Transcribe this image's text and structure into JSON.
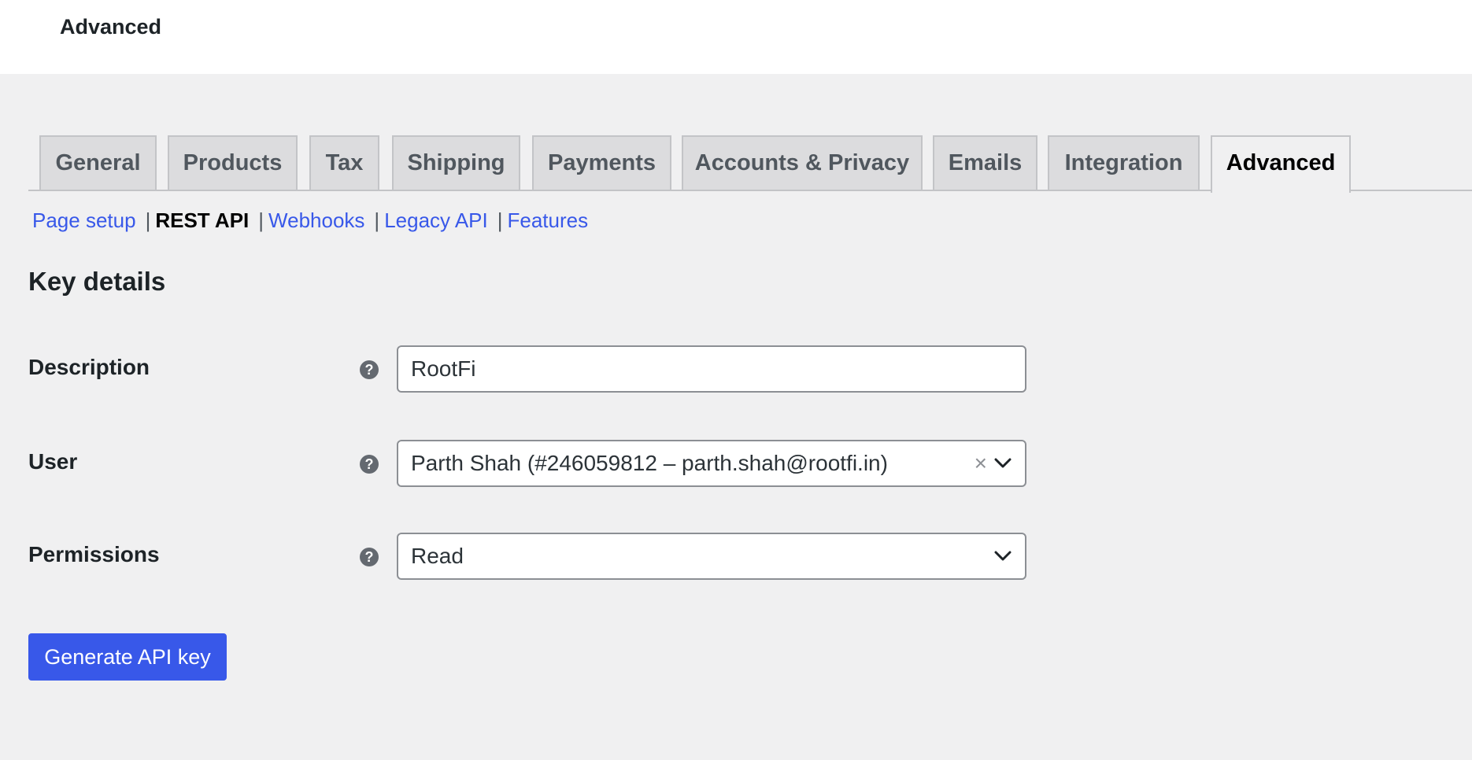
{
  "header": {
    "title": "Advanced"
  },
  "tabs": [
    {
      "label": "General"
    },
    {
      "label": "Products"
    },
    {
      "label": "Tax"
    },
    {
      "label": "Shipping"
    },
    {
      "label": "Payments"
    },
    {
      "label": "Accounts & Privacy"
    },
    {
      "label": "Emails"
    },
    {
      "label": "Integration"
    },
    {
      "label": "Advanced",
      "active": true
    }
  ],
  "subnav": {
    "items": [
      {
        "label": "Page setup"
      },
      {
        "label": "REST API",
        "current": true
      },
      {
        "label": "Webhooks"
      },
      {
        "label": "Legacy API"
      },
      {
        "label": "Features"
      }
    ],
    "separator": "|"
  },
  "section": {
    "title": "Key details"
  },
  "form": {
    "description": {
      "label": "Description",
      "value": "RootFi"
    },
    "user": {
      "label": "User",
      "value": "Parth Shah (#246059812 – parth.shah@rootfi.in)",
      "clear_symbol": "×"
    },
    "permissions": {
      "label": "Permissions",
      "value": "Read"
    },
    "help_symbol": "?"
  },
  "actions": {
    "generate_label": "Generate API key"
  },
  "colors": {
    "accent": "#3858e9",
    "background": "#f0f0f1",
    "tab_inactive": "#dcdcde"
  }
}
